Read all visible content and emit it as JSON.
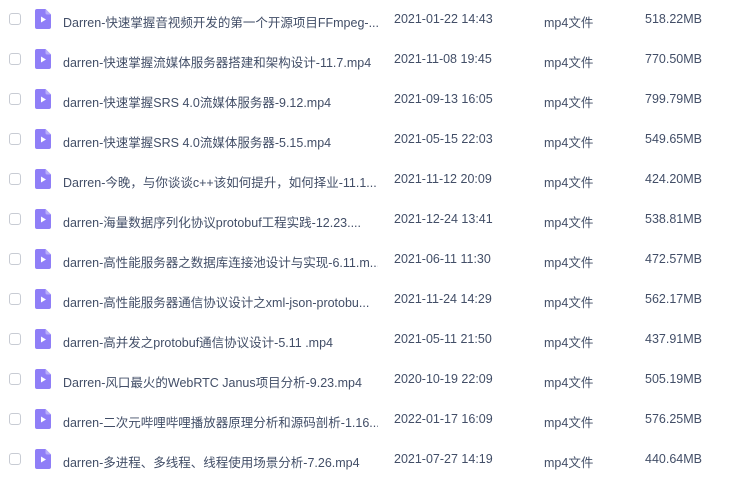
{
  "files": [
    {
      "name": "Darren-快速掌握音视频开发的第一个开源项目FFmpeg-...",
      "modified": "2021-01-22 14:43",
      "type": "mp4文件",
      "size": "518.22MB"
    },
    {
      "name": "darren-快速掌握流媒体服务器搭建和架构设计-11.7.mp4",
      "modified": "2021-11-08 19:45",
      "type": "mp4文件",
      "size": "770.50MB"
    },
    {
      "name": "darren-快速掌握SRS 4.0流媒体服务器-9.12.mp4",
      "modified": "2021-09-13 16:05",
      "type": "mp4文件",
      "size": "799.79MB"
    },
    {
      "name": "darren-快速掌握SRS 4.0流媒体服务器-5.15.mp4",
      "modified": "2021-05-15 22:03",
      "type": "mp4文件",
      "size": "549.65MB"
    },
    {
      "name": "Darren-今晚，与你谈谈c++该如何提升，如何择业-11.1...",
      "modified": "2021-11-12 20:09",
      "type": "mp4文件",
      "size": "424.20MB"
    },
    {
      "name": "darren-海量数据序列化协议protobuf工程实践-12.23....",
      "modified": "2021-12-24 13:41",
      "type": "mp4文件",
      "size": "538.81MB"
    },
    {
      "name": "darren-高性能服务器之数据库连接池设计与实现-6.11.m...",
      "modified": "2021-06-11 11:30",
      "type": "mp4文件",
      "size": "472.57MB"
    },
    {
      "name": "darren-高性能服务器通信协议设计之xml-json-protobu...",
      "modified": "2021-11-24 14:29",
      "type": "mp4文件",
      "size": "562.17MB"
    },
    {
      "name": "darren-高并发之protobuf通信协议设计-5.11 .mp4",
      "modified": "2021-05-11 21:50",
      "type": "mp4文件",
      "size": "437.91MB"
    },
    {
      "name": "Darren-风口最火的WebRTC Janus项目分析-9.23.mp4",
      "modified": "2020-10-19 22:09",
      "type": "mp4文件",
      "size": "505.19MB"
    },
    {
      "name": "darren-二次元哔哩哔哩播放器原理分析和源码剖析-1.16....",
      "modified": "2022-01-17 16:09",
      "type": "mp4文件",
      "size": "576.25MB"
    },
    {
      "name": "darren-多进程、多线程、线程使用场景分析-7.26.mp4",
      "modified": "2021-07-27 14:19",
      "type": "mp4文件",
      "size": "440.64MB"
    }
  ],
  "icon": "video-file-icon",
  "colors": {
    "text": "#424e67",
    "icon": "#8f7ef7",
    "checkbox_border": "#c8ccd4"
  }
}
